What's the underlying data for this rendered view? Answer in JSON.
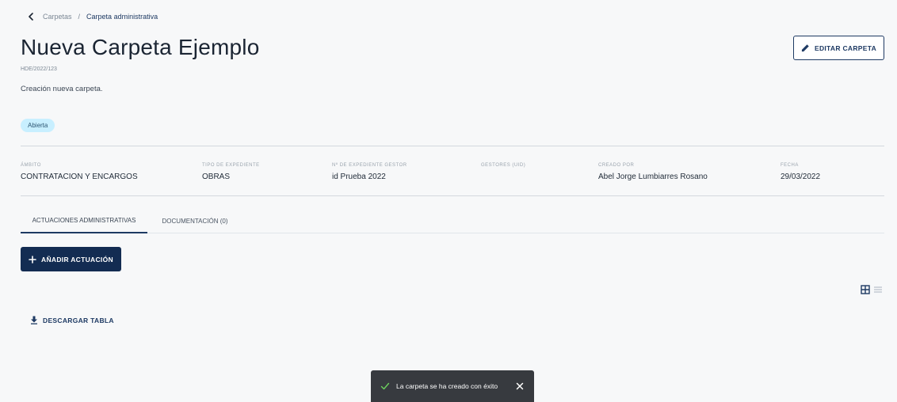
{
  "breadcrumb": {
    "parent": "Carpetas",
    "separator": "/",
    "current": "Carpeta administrativa"
  },
  "folder": {
    "title": "Nueva Carpeta Ejemplo",
    "code": "HDE/2022/123",
    "description": "Creación nueva carpeta.",
    "status": "Abierta"
  },
  "actions": {
    "edit_label": "EDITAR CARPETA",
    "add_label": "AÑADIR ACTUACIÓN",
    "download_label": "DESCARGAR TABLA"
  },
  "info": [
    {
      "label": "ÁMBITO",
      "value": "CONTRATACION Y ENCARGOS"
    },
    {
      "label": "TIPO DE EXPEDIENTE",
      "value": "OBRAS"
    },
    {
      "label": "Nº DE EXPEDIENTE GESTOR",
      "value": "id Prueba 2022"
    },
    {
      "label": "GESTORES (UID)",
      "value": ""
    },
    {
      "label": "CREADO POR",
      "value": "Abel Jorge Lumbiarres Rosano"
    },
    {
      "label": "FECHA",
      "value": "29/03/2022"
    }
  ],
  "tabs": [
    {
      "label": "ACTUACIONES ADMINISTRATIVAS",
      "active": true
    },
    {
      "label": "DOCUMENTACIÓN (0)",
      "active": false
    }
  ],
  "toast": {
    "message": "La carpeta se ha creado con éxito"
  },
  "icons": {
    "back": "chevron-left-icon",
    "edit": "pencil-icon",
    "add": "plus-icon",
    "grid_view": "grid-icon",
    "list_view": "list-icon",
    "download": "download-icon",
    "success": "check-icon",
    "close": "close-icon"
  },
  "colors": {
    "primary": "#132c52",
    "accent": "#1e3a63",
    "badge_bg": "#c8efff",
    "toast_bg": "#373a3f",
    "success": "#6ccf5e",
    "background": "#f7f8f9"
  }
}
